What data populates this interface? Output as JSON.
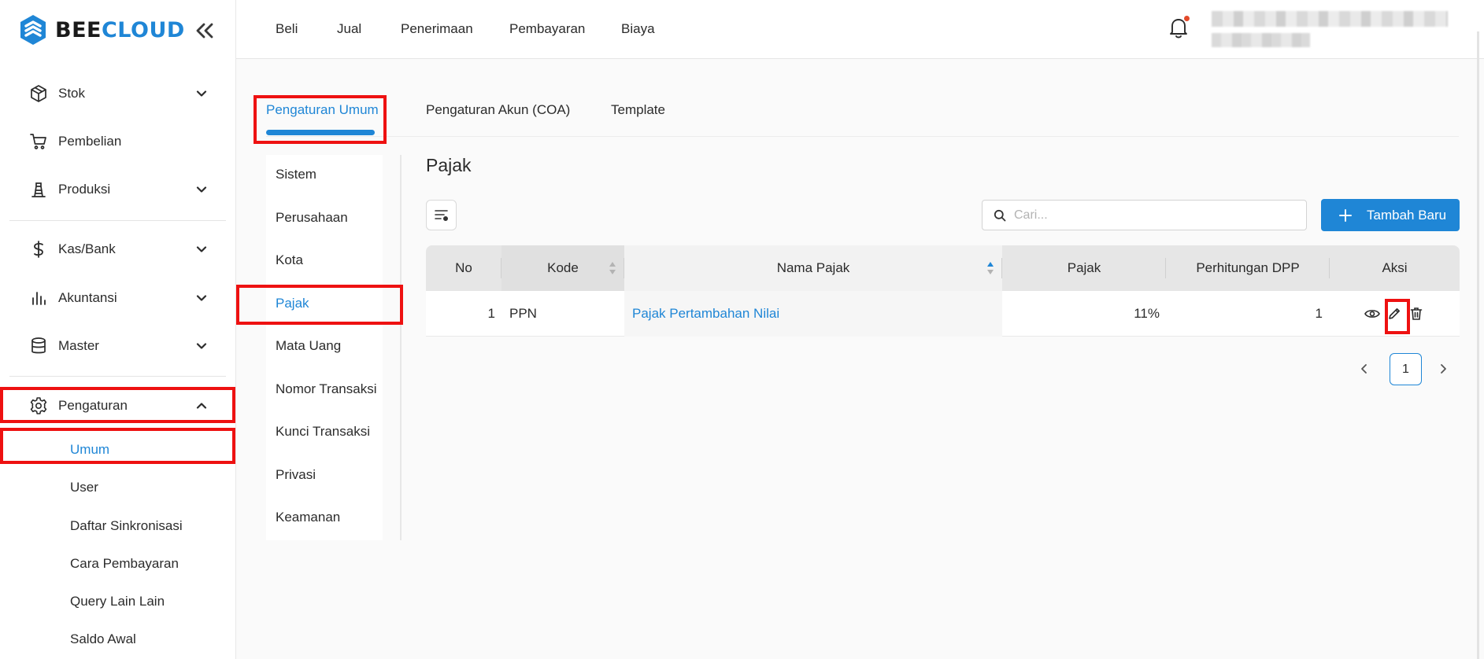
{
  "brand": {
    "name_part1": "BEE",
    "name_part2": "CLOUD",
    "accent": "#1f86d6",
    "highlight": "#ee1111"
  },
  "sidebar": {
    "items": [
      {
        "label": "Stok",
        "icon": "box-icon"
      },
      {
        "label": "Pembelian",
        "icon": "cart-icon"
      },
      {
        "label": "Produksi",
        "icon": "production-icon"
      },
      {
        "label": "Kas/Bank",
        "icon": "dollar-icon"
      },
      {
        "label": "Akuntansi",
        "icon": "bar-chart-icon"
      },
      {
        "label": "Master",
        "icon": "database-icon"
      },
      {
        "label": "Pengaturan",
        "icon": "gear-icon"
      }
    ],
    "sub_items": [
      "Umum",
      "User",
      "Daftar Sinkronisasi",
      "Cara Pembayaran",
      "Query Lain Lain",
      "Saldo Awal"
    ]
  },
  "topnav": [
    "Beli",
    "Jual",
    "Penerimaan",
    "Pembayaran",
    "Biaya"
  ],
  "tabs": [
    "Pengaturan Umum",
    "Pengaturan Akun (COA)",
    "Template"
  ],
  "submenu": [
    "Sistem",
    "Perusahaan",
    "Kota",
    "Pajak",
    "Mata Uang",
    "Nomor Transaksi",
    "Kunci Transaksi",
    "Privasi",
    "Keamanan"
  ],
  "content": {
    "title": "Pajak",
    "search_placeholder": "Cari...",
    "add_label": "Tambah Baru"
  },
  "table": {
    "headers": [
      "No",
      "Kode",
      "Nama Pajak",
      "Pajak",
      "Perhitungan DPP",
      "Aksi"
    ],
    "rows": [
      {
        "no": "1",
        "kode": "PPN",
        "nama": "Pajak Pertambahan Nilai",
        "pajak": "11%",
        "dpp": "1"
      }
    ]
  },
  "pagination": {
    "current": "1"
  }
}
